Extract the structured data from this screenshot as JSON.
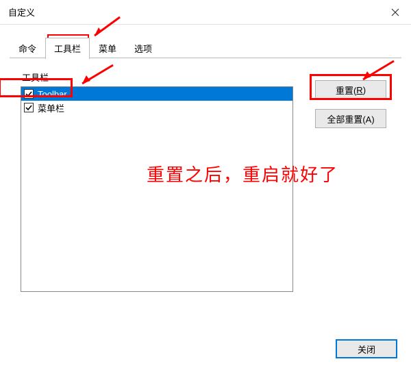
{
  "title": "自定义",
  "tabs": {
    "items": [
      {
        "label": "命令",
        "active": false
      },
      {
        "label": "工具栏",
        "active": true
      },
      {
        "label": "菜单",
        "active": false
      },
      {
        "label": "选项",
        "active": false
      }
    ]
  },
  "list": {
    "label": "工具栏",
    "items": [
      {
        "label": "Toolbar",
        "checked": true,
        "selected": true
      },
      {
        "label": "菜单栏",
        "checked": true,
        "selected": false
      }
    ]
  },
  "buttons": {
    "reset_prefix": "重置(",
    "reset_accel": "R",
    "reset_suffix": ")",
    "reset_all": "全部重置(A)",
    "close": "关闭"
  },
  "annotation": "重置之后，重启就好了"
}
